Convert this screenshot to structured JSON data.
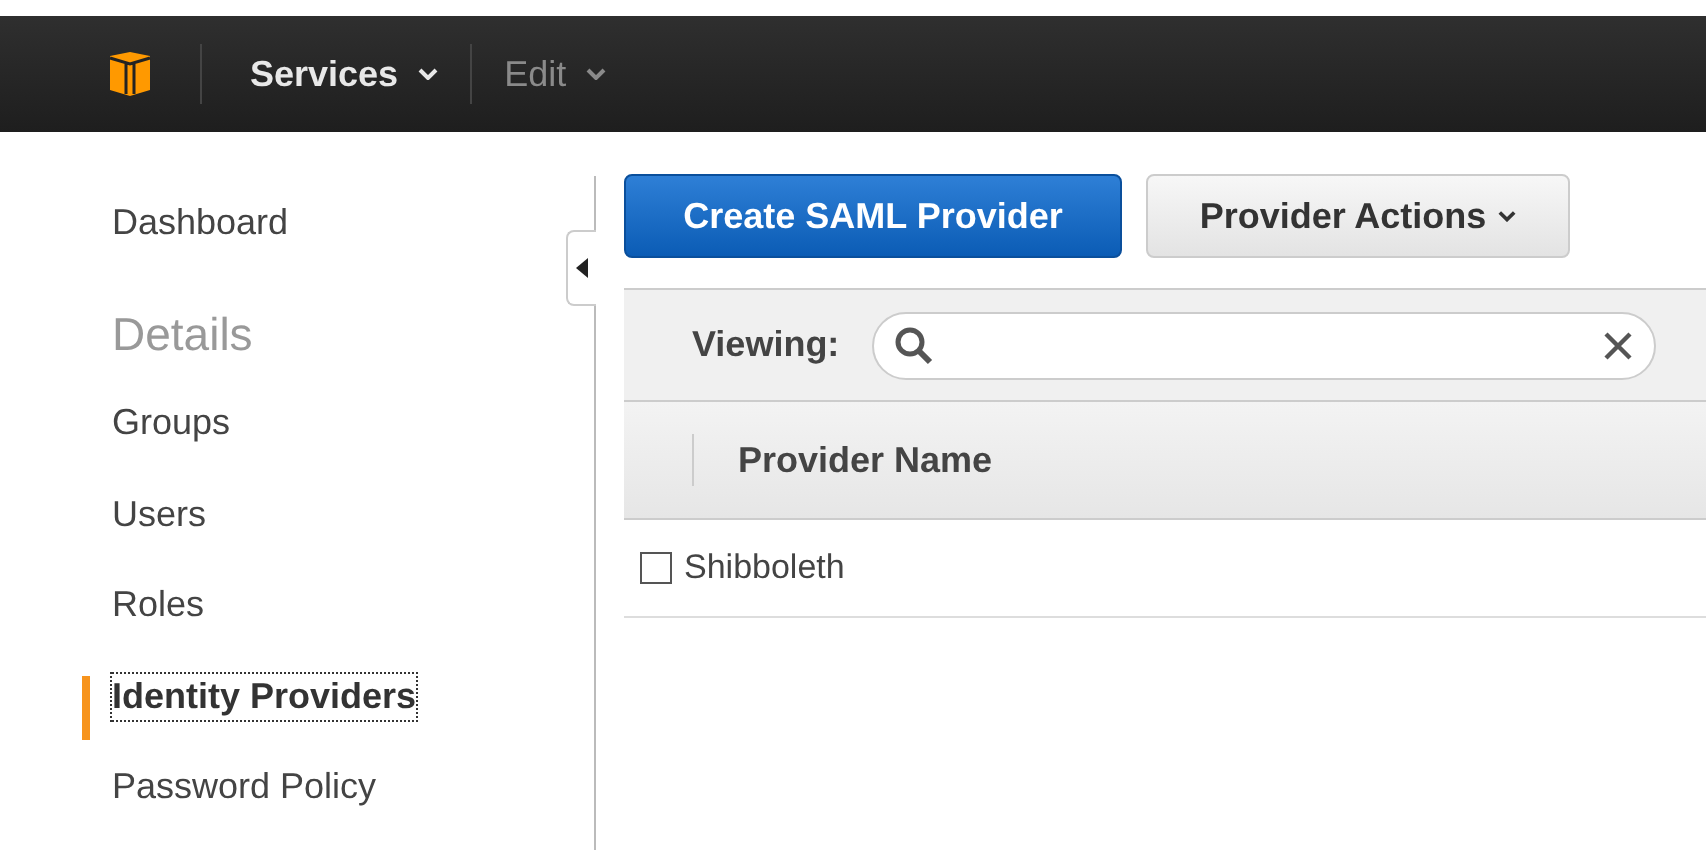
{
  "top_nav": {
    "menus": [
      {
        "label": "Services",
        "disabled": false
      },
      {
        "label": "Edit",
        "disabled": true
      }
    ]
  },
  "sidebar": {
    "items": [
      {
        "kind": "link",
        "label": "Dashboard",
        "selected": false
      },
      {
        "kind": "heading",
        "label": "Details"
      },
      {
        "kind": "link",
        "label": "Groups",
        "selected": false
      },
      {
        "kind": "link",
        "label": "Users",
        "selected": false
      },
      {
        "kind": "link",
        "label": "Roles",
        "selected": false
      },
      {
        "kind": "link",
        "label": "Identity Providers",
        "selected": true
      },
      {
        "kind": "link",
        "label": "Password Policy",
        "selected": false
      }
    ]
  },
  "toolbar": {
    "primary_button": "Create SAML Provider",
    "actions_button": "Provider Actions"
  },
  "filter": {
    "label": "Viewing:"
  },
  "table": {
    "columns": [
      "Provider Name"
    ],
    "rows": [
      {
        "name": "Shibboleth",
        "checked": false
      }
    ]
  }
}
